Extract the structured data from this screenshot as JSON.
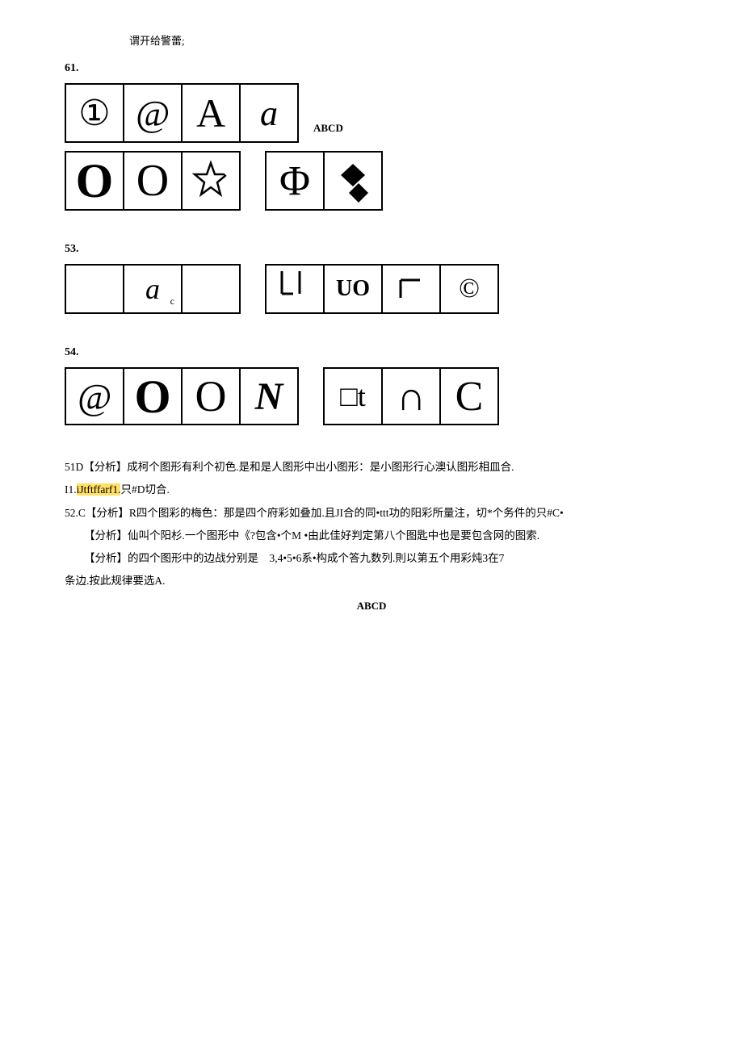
{
  "intro": {
    "text": "谓开给警蕾;"
  },
  "q61": {
    "label": "61.",
    "answer": "ABCD",
    "row1": {
      "cells": [
        {
          "sym": "circled-1",
          "display": "①"
        },
        {
          "sym": "at",
          "display": "@"
        },
        {
          "sym": "A-serif",
          "display": "A"
        },
        {
          "sym": "a-italic",
          "display": "a"
        }
      ]
    },
    "row2": {
      "sets": [
        [
          {
            "sym": "O-bold",
            "display": "O"
          },
          {
            "sym": "O-normal",
            "display": "O"
          },
          {
            "sym": "star-partial",
            "display": "star"
          }
        ],
        [
          {
            "sym": "phi",
            "display": "Φ"
          },
          {
            "sym": "diamond",
            "display": "diamond"
          }
        ]
      ]
    }
  },
  "q53": {
    "label": "53.",
    "row": {
      "set1": [
        {
          "sym": "empty",
          "display": ""
        },
        {
          "sym": "a-small",
          "display": "a",
          "sub": "c"
        },
        {
          "sym": "empty",
          "display": ""
        }
      ],
      "set2": [
        {
          "sym": "LI",
          "display": "LI"
        },
        {
          "sym": "UO",
          "display": "UO"
        },
        {
          "sym": "corner",
          "display": "⌐"
        },
        {
          "sym": "copyright",
          "display": "©"
        }
      ]
    }
  },
  "q54": {
    "label": "54.",
    "row": {
      "set1": [
        {
          "sym": "at",
          "display": "@"
        },
        {
          "sym": "O-bold",
          "display": "O"
        },
        {
          "sym": "O-normal",
          "display": "O"
        },
        {
          "sym": "N-italic",
          "display": "N"
        }
      ],
      "set2": [
        {
          "sym": "sq-t",
          "display": "□t"
        },
        {
          "sym": "omega",
          "display": "∩"
        },
        {
          "sym": "C-open",
          "display": "C"
        }
      ]
    }
  },
  "analysis": {
    "line1": "51D【分析】成柯个图形有利个初色.是和是人图形中出小图形：是小图形行心澳认图形相皿合.",
    "line2": "I1.",
    "line2_highlight": "iJtftffarf1.",
    "line2_end": "只#D切合.",
    "line3": "52.C【分析】R四个图彩的梅色：那是四个府彩如叠加.且JI合的同•ttt功的阳彩所量注，切*个务件的只#C•",
    "line4_indent1": "【分析】仙叫个阳杉.一个图形中《?包含•个M •由此佳好判定第八个图匙中也是要包含网的图索.",
    "line4_indent2": "【分析】的四个图形中的边战分别是　3,4•5•6系•构成个答九数列.則以第五个用彩炖3在7",
    "line5": "条边.按此规律要选A.",
    "answer_bottom": "ABCD"
  }
}
